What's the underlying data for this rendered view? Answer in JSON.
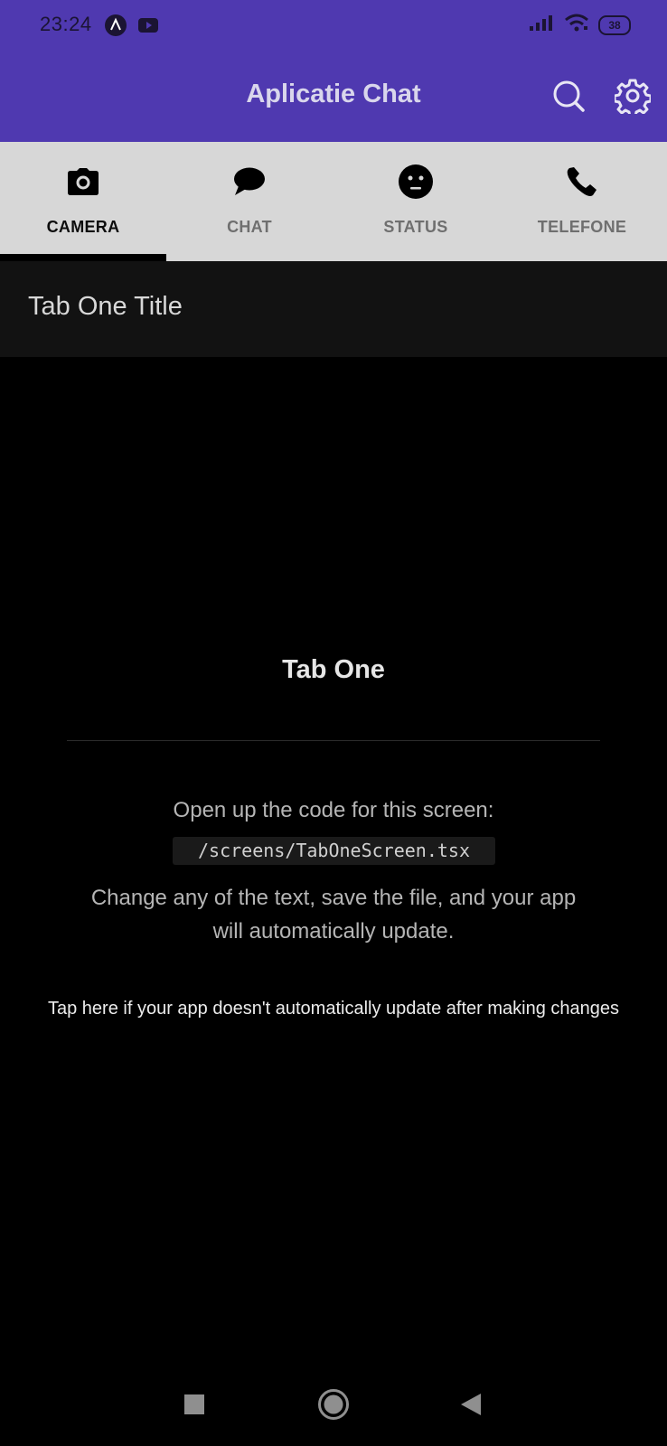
{
  "status_bar": {
    "time": "23:24",
    "battery_level": "38",
    "icons": [
      "expo-app-icon",
      "youtube-icon",
      "signal-icon",
      "wifi-icon",
      "battery-icon"
    ]
  },
  "header": {
    "title": "Aplicatie Chat",
    "actions": [
      "search-icon",
      "settings-icon"
    ]
  },
  "tabs": [
    {
      "label": "CAMERA",
      "icon": "camera-icon",
      "active": true
    },
    {
      "label": "CHAT",
      "icon": "chat-bubble-icon",
      "active": false
    },
    {
      "label": "STATUS",
      "icon": "face-icon",
      "active": false
    },
    {
      "label": "TELEFONE",
      "icon": "phone-icon",
      "active": false
    }
  ],
  "screen": {
    "title": "Tab One Title",
    "content_title": "Tab One",
    "intro": "Open up the code for this screen:",
    "code_path": "/screens/TabOneScreen.tsx",
    "change_text": "Change any of the text, save the file, and your app will automatically update.",
    "help_link": "Tap here if your app doesn't automatically update after making changes"
  },
  "nav_bar": {
    "buttons": [
      "recents-button",
      "home-button",
      "back-button"
    ]
  },
  "colors": {
    "primary": "#4f39b0",
    "tab_bar_bg": "#d7d7d7",
    "screen_header_bg": "#121212",
    "content_bg": "#000000",
    "active_indicator": "#000000"
  }
}
